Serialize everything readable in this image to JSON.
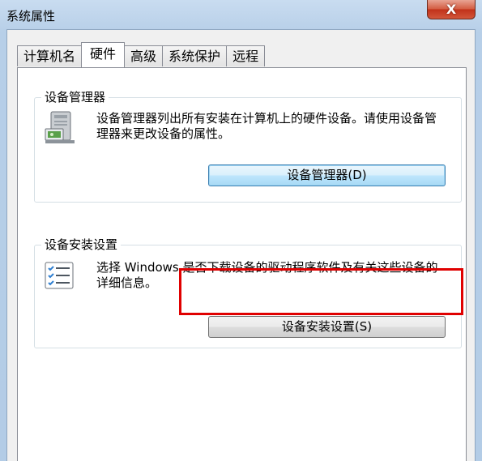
{
  "window": {
    "title": "系统属性",
    "close_label": "X"
  },
  "tabs": [
    {
      "label": "计算机名"
    },
    {
      "label": "硬件",
      "active": true
    },
    {
      "label": "高级"
    },
    {
      "label": "系统保护"
    },
    {
      "label": "远程"
    }
  ],
  "device_manager": {
    "title": "设备管理器",
    "description": "设备管理器列出所有安装在计算机上的硬件设备。请使用设备管理器来更改设备的属性。",
    "button_label": "设备管理器(D)",
    "icon": "device-manager-icon"
  },
  "device_installation": {
    "title": "设备安装设置",
    "description": "选择 Windows 是否下载设备的驱动程序软件及有关这些设备的详细信息。",
    "button_label": "设备安装设置(S)",
    "icon": "checklist-icon"
  },
  "colors": {
    "highlight": "#e00000",
    "focus_border": "#3c7fb1"
  }
}
